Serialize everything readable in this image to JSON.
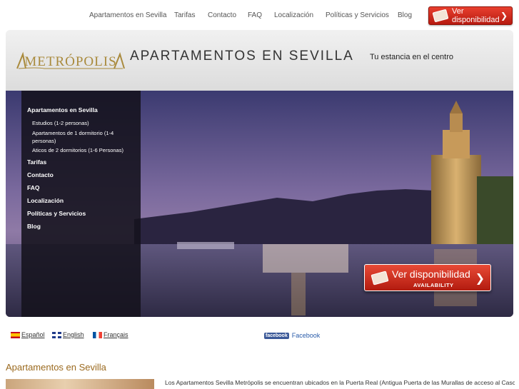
{
  "topnav": {
    "items": [
      "Apartamentos en Sevilla",
      "Tarifas",
      "Contacto",
      "FAQ",
      "Localización",
      "Políticas y Servicios",
      "Blog"
    ],
    "cta_label": "Ver disponibilidad"
  },
  "header": {
    "logo_text": "METRÓPOLIS",
    "site_title": "APARTAMENTOS EN SEVILLA",
    "tagline": "Tu estancia en el centro"
  },
  "sidemenu": {
    "items": [
      "Apartamentos en Sevilla",
      "Tarifas",
      "Contacto",
      "FAQ",
      "Localización",
      "Políticas y Servicios",
      "Blog"
    ],
    "subitems": [
      "Estudios (1-2 personas)",
      "Apartamentos de 1 dormitorio (1-4 personas)",
      "Aticos de 2 dormitorios (1-6 Personas)"
    ]
  },
  "availability": {
    "label": "Ver disponibilidad",
    "sublabel": "AVAILABILITY"
  },
  "languages": [
    "Español",
    "English",
    "Français"
  ],
  "facebook": {
    "badge": "facebook",
    "label": "Facebook"
  },
  "content": {
    "section_title": "Apartamentos en Sevilla",
    "intro": "Los Apartamentos Sevilla Metrópolis se encuentran ubicados en la Puerta Real (Antigua Puerta de las Murallas de acceso al Casco"
  },
  "colors": {
    "accent_red": "#c9271a",
    "title_brown": "#9b6a1f",
    "facebook_blue": "#3b5998"
  }
}
